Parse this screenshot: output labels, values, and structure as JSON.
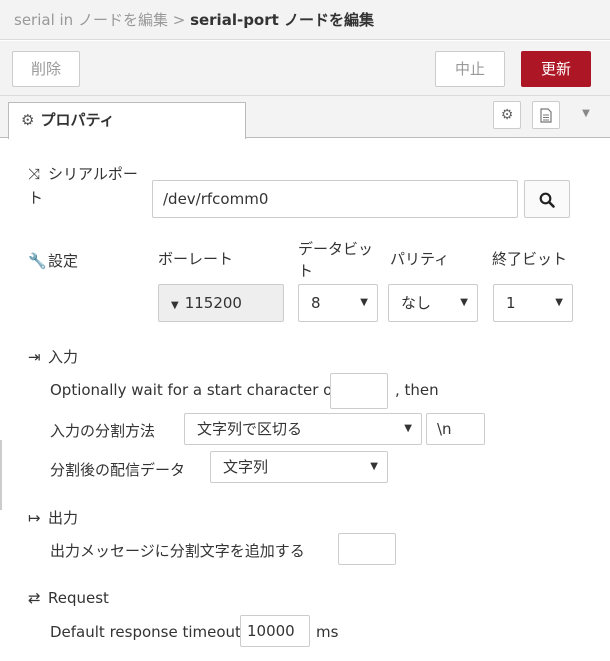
{
  "breadcrumb": {
    "parent": "serial in ノードを編集",
    "separator": " > ",
    "current": "serial-port ノードを編集"
  },
  "toolbar": {
    "delete_label": "削除",
    "cancel_label": "中止",
    "update_label": "更新"
  },
  "tabs": {
    "properties_label": "プロパティ"
  },
  "serial_port": {
    "label": "シリアルポート",
    "value": "/dev/rfcomm0"
  },
  "settings": {
    "label": "設定",
    "baud_header": "ボーレート",
    "databits_header": "データビット",
    "parity_header": "パリティ",
    "stopbits_header": "終了ビット",
    "baud_value": "115200",
    "databits_value": "8",
    "parity_value": "なし",
    "stopbits_value": "1"
  },
  "input": {
    "section_label": "入力",
    "wait_text": "Optionally wait for a start character of",
    "wait_value": "",
    "then_text": ", then",
    "split_label": "入力の分割方法",
    "split_value": "文字列で区切る",
    "split_char_value": "\\n",
    "deliver_label": "分割後の配信データ",
    "deliver_value": "文字列"
  },
  "output": {
    "section_label": "出力",
    "add_char_label": "出力メッセージに分割文字を追加する",
    "add_char_value": ""
  },
  "request": {
    "section_label": "Request",
    "timeout_label": "Default response timeout",
    "timeout_value": "10000",
    "timeout_unit": "ms"
  },
  "colors": {
    "accent": "#ad1625",
    "header_bg": "#f3f3f3"
  }
}
